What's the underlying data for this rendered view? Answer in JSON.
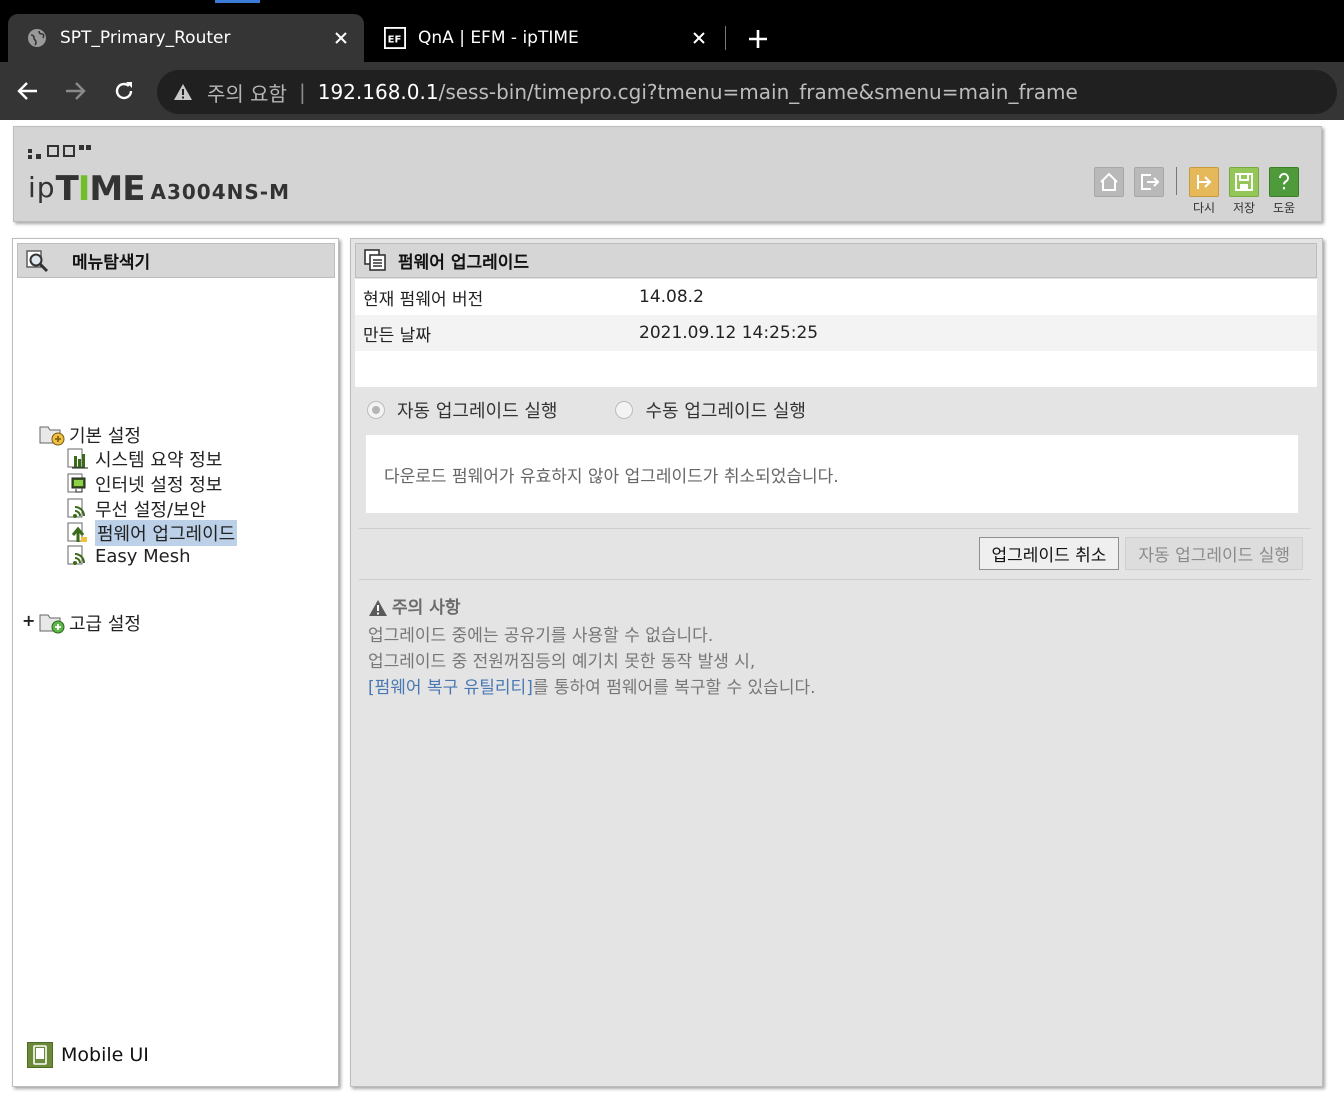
{
  "browser": {
    "tabs": [
      {
        "title": "SPT_Primary_Router",
        "active": true,
        "favicon": "globe-icon"
      },
      {
        "title": "QnA | EFM - ipTIME",
        "active": false,
        "favicon": "efm-logo-icon"
      }
    ],
    "address": {
      "security_text": "주의 요함",
      "host": "192.168.0.1",
      "path": "/sess-bin/timepro.cgi?tmenu=main_frame&smenu=main_frame"
    }
  },
  "header": {
    "logo_prefix": "ip",
    "logo_brand_t": "T",
    "logo_brand_i": "I",
    "logo_brand_me": "ME",
    "model": "A3004NS-M",
    "buttons": {
      "redo": "다시",
      "save": "저장",
      "help": "도움"
    }
  },
  "sidebar": {
    "title": "메뉴탐색기",
    "groups": [
      {
        "label": "기본 설정",
        "items": [
          {
            "label": "시스템 요약 정보",
            "icon": "chart-icon"
          },
          {
            "label": "인터넷 설정 정보",
            "icon": "monitor-icon"
          },
          {
            "label": "무선 설정/보안",
            "icon": "wireless-icon"
          },
          {
            "label": "펌웨어 업그레이드",
            "icon": "upgrade-icon",
            "selected": true
          },
          {
            "label": "Easy Mesh",
            "icon": "wireless-icon"
          }
        ]
      },
      {
        "label": "고급 설정",
        "items": []
      }
    ],
    "mobile_label": "Mobile UI"
  },
  "main": {
    "title": "펌웨어 업그레이드",
    "info": [
      {
        "key": "현재 펌웨어 버전",
        "value": "14.08.2"
      },
      {
        "key": "만든 날짜",
        "value": "2021.09.12 14:25:25"
      }
    ],
    "radio_auto": "자동 업그레이드 실행",
    "radio_manual": "수동 업그레이드 실행",
    "message": "다운로드 펌웨어가 유효하지 않아 업그레이드가 취소되었습니다.",
    "btn_cancel": "업그레이드 취소",
    "btn_auto": "자동 업그레이드 실행",
    "notes": {
      "title": "주의 사항",
      "line1": "업그레이드 중에는 공유기를 사용할 수 없습니다.",
      "line2": "업그레이드 중 전원꺼짐등의 예기치 못한 동작 발생 시,",
      "link": "[펌웨어 복구 유틸리티]",
      "line3_rest": "를 통하여 펌웨어를 복구할 수 있습니다."
    }
  },
  "colors": {
    "redo": "#e5b95a",
    "save": "#95c65a",
    "help": "#4f9a3a",
    "selected": "#bcd0e8",
    "link": "#4a78b3"
  }
}
